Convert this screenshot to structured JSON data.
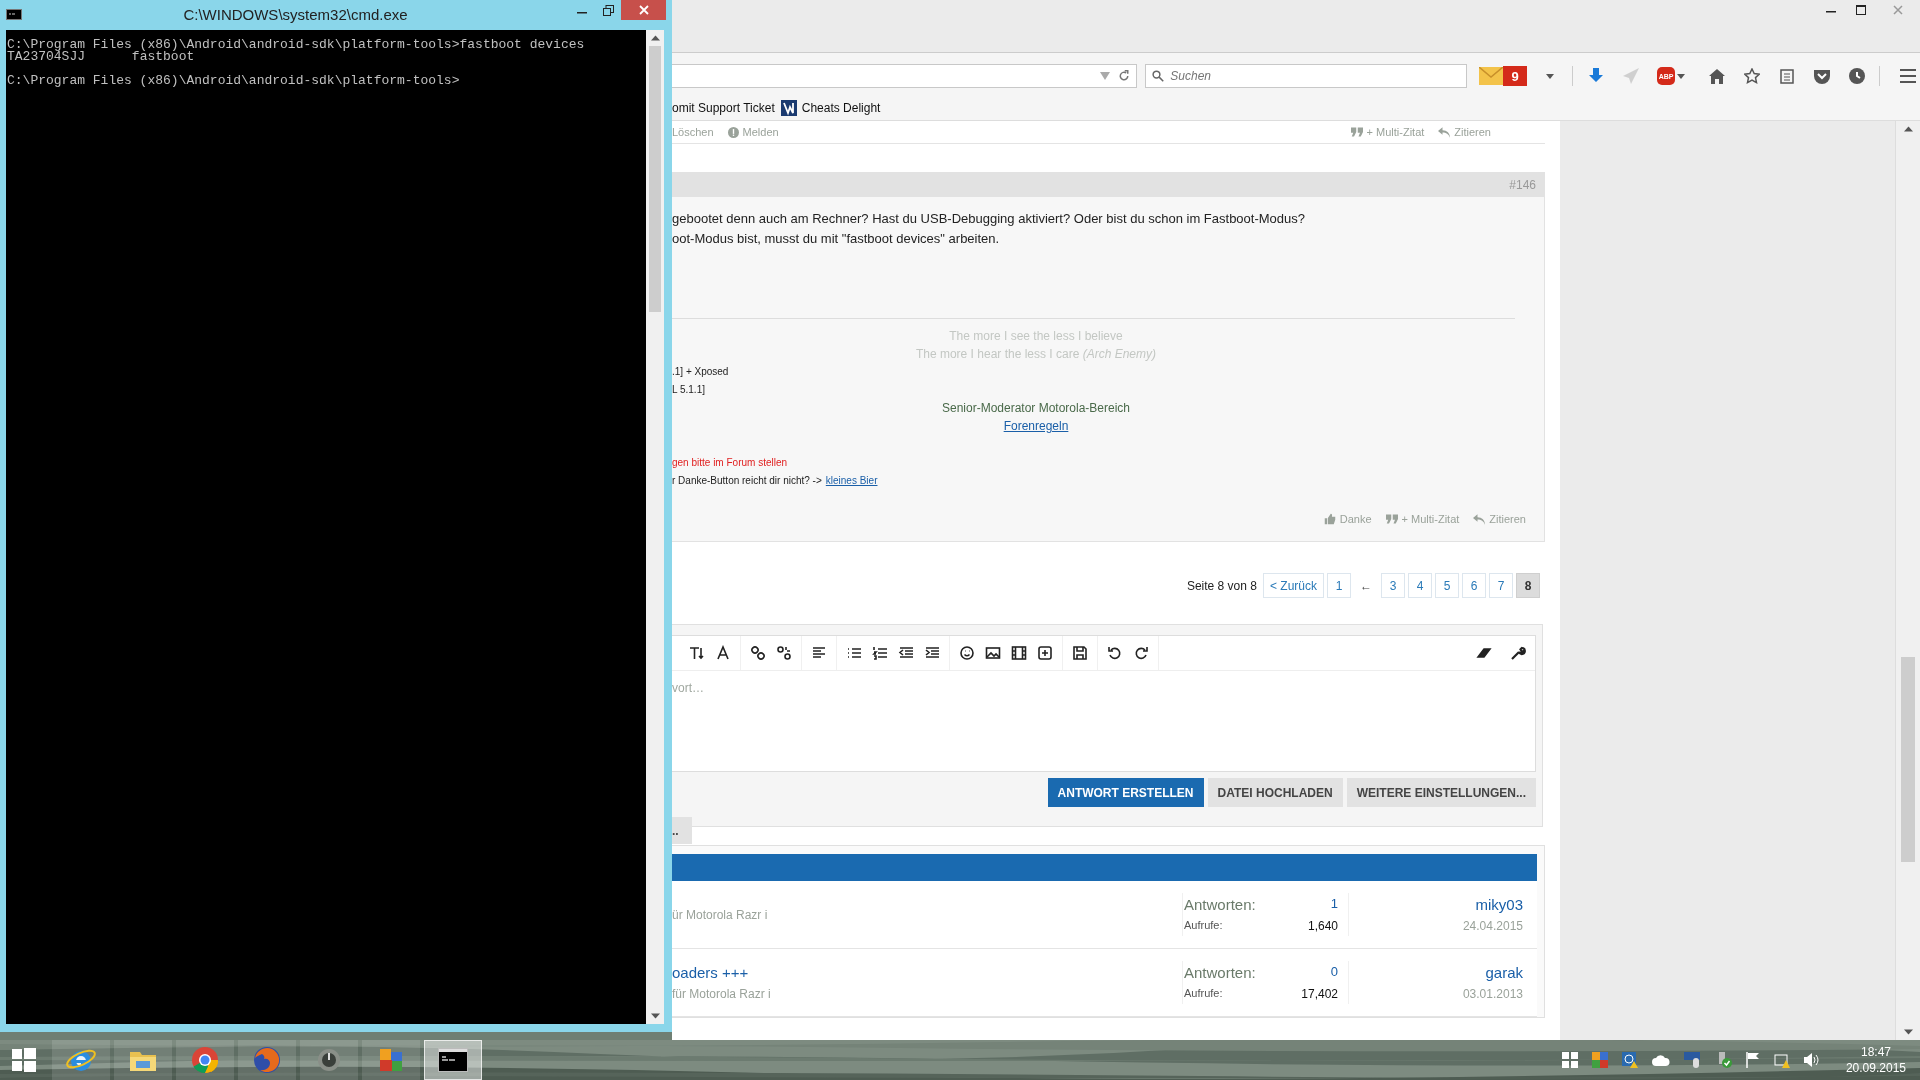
{
  "cmd": {
    "title": "C:\\WINDOWS\\system32\\cmd.exe",
    "blocks": [
      [
        "C:\\Program Files (x86)\\Android\\android-sdk\\platform-tools>fastboot devices",
        "TA23704SJJ\tfastboot"
      ],
      [
        "C:\\Program Files (x86)\\Android\\android-sdk\\platform-tools>"
      ]
    ]
  },
  "browser": {
    "search": {
      "placeholder": "Suchen"
    },
    "mail_count": "9",
    "adblock_label": "ABP",
    "bookmarks": [
      {
        "kind": "plain",
        "label": "omit Support Ticket"
      },
      {
        "kind": "logo",
        "label": "Cheats Delight"
      }
    ],
    "prev_post_actions": [
      {
        "kind": "delete",
        "label": "Löschen"
      },
      {
        "kind": "report",
        "label": "Melden"
      },
      {
        "kind": "multiquote",
        "label": "+ Multi-Zitat"
      },
      {
        "kind": "quote",
        "label": "Zitieren"
      }
    ],
    "post": {
      "number": "#146",
      "body": [
        "gebootet denn auch am Rechner? Hast du USB-Debugging aktiviert? Oder bist du schon im Fastboot-Modus?",
        "oot-Modus bist, musst du mit \"fastboot devices\" arbeiten."
      ],
      "signature": {
        "quote": [
          "The more I see the less I believe",
          "The more I hear the less I care *(Arch Enemy)*"
        ],
        "devices": [
          ".1] + Xposed",
          "L 5.1.1]"
        ],
        "role": "Senior-Moderator Motorola-Bereich",
        "rules_link": "Forenregeln",
        "notice": "gen bitte im Forum stellen",
        "donate_text": "r Danke-Button reicht dir nicht? ->",
        "donate_link": "kleines Bier"
      },
      "actions": [
        {
          "kind": "like",
          "label": "Danke"
        },
        {
          "kind": "multiquote",
          "label": "+ Multi-Zitat"
        },
        {
          "kind": "quote",
          "label": "Zitieren"
        }
      ]
    },
    "pagination": {
      "label": "Seite 8 von 8",
      "items": [
        {
          "kind": "link",
          "label": "< Zurück",
          "selected": false
        },
        {
          "kind": "link",
          "label": "1",
          "selected": false
        },
        {
          "kind": "gap",
          "label": "←"
        },
        {
          "kind": "link",
          "label": "3",
          "selected": false
        },
        {
          "kind": "link",
          "label": "4",
          "selected": false
        },
        {
          "kind": "link",
          "label": "5",
          "selected": false
        },
        {
          "kind": "link",
          "label": "6",
          "selected": false
        },
        {
          "kind": "link",
          "label": "7",
          "selected": false
        },
        {
          "kind": "link",
          "label": "8",
          "selected": true
        }
      ]
    },
    "editor": {
      "placeholder": "vort…",
      "side_button": "..",
      "buttons": [
        {
          "kind": "primary",
          "label": "ANTWORT ERSTELLEN"
        },
        {
          "kind": "secondary",
          "label": "DATEI HOCHLADEN"
        },
        {
          "kind": "secondary",
          "label": "WEITERE EINSTELLUNGEN..."
        }
      ]
    },
    "threads": [
      {
        "subtitle": "ür Motorola Razr i",
        "replies_label": "Antworten:",
        "replies": "1",
        "views_label": "Aufrufe:",
        "views": "1,640",
        "user": "miky03",
        "date": "24.04.2015"
      },
      {
        "title": "oaders +++",
        "subtitle": "für Motorola Razr i",
        "replies_label": "Antworten:",
        "replies": "0",
        "views_label": "Aufrufe:",
        "views": "17,402",
        "user": "garak",
        "date": "03.01.2013"
      }
    ]
  },
  "taskbar": {
    "apps": [
      {
        "kind": "ie",
        "selected": false
      },
      {
        "kind": "explorer",
        "selected": false
      },
      {
        "kind": "chrome",
        "selected": false
      },
      {
        "kind": "firefox",
        "selected": false
      },
      {
        "kind": "dial",
        "selected": false
      },
      {
        "kind": "blocks",
        "selected": false
      },
      {
        "kind": "cmd",
        "selected": true
      }
    ],
    "clock": {
      "time": "18:47",
      "date": "20.09.2015"
    }
  }
}
